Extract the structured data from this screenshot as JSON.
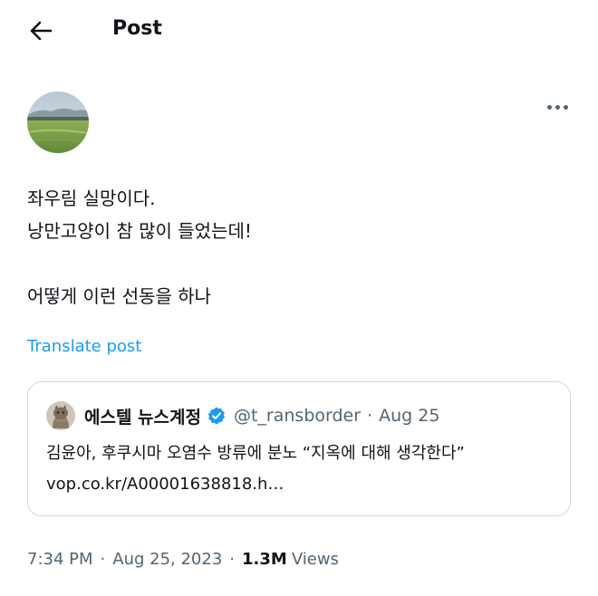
{
  "header": {
    "back_icon": "arrow-left-icon",
    "title": "Post"
  },
  "post": {
    "author_avatar": "landscape-field-avatar",
    "more_icon": "more-horizontal-icon",
    "text_lines": [
      "좌우림 실망이다.",
      "낭만고양이 참 많이 들었는데!",
      "",
      "어떻게 이런 선동을 하나"
    ],
    "translate_label": "Translate post",
    "link_color": "#1d9bf0"
  },
  "quote": {
    "avatar": "cat-avatar",
    "name": "에스텔 뉴스계정",
    "verified_icon": "verified-badge-icon",
    "verified_color": "#1d9bf0",
    "handle": "@t_ransborder",
    "separator": "·",
    "date": "Aug 25",
    "text_line1": "김윤아, 후쿠시마 오염수 방류에 분노 “지옥에 대해 생각한다”",
    "text_line2": "vop.co.kr/A00001638818.h…"
  },
  "meta": {
    "time": "7:34 PM",
    "separator": "·",
    "date": "Aug 25, 2023",
    "views_count": "1.3M",
    "views_label": "Views"
  }
}
